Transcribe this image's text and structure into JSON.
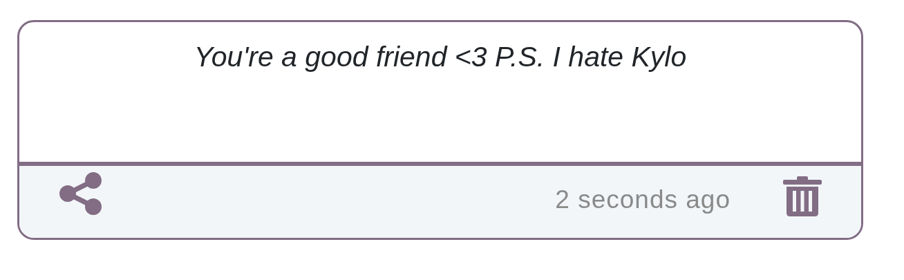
{
  "card": {
    "message": "You're a good friend <3 P.S. I hate Kylo",
    "footer": {
      "timestamp": "2 seconds ago"
    }
  }
}
